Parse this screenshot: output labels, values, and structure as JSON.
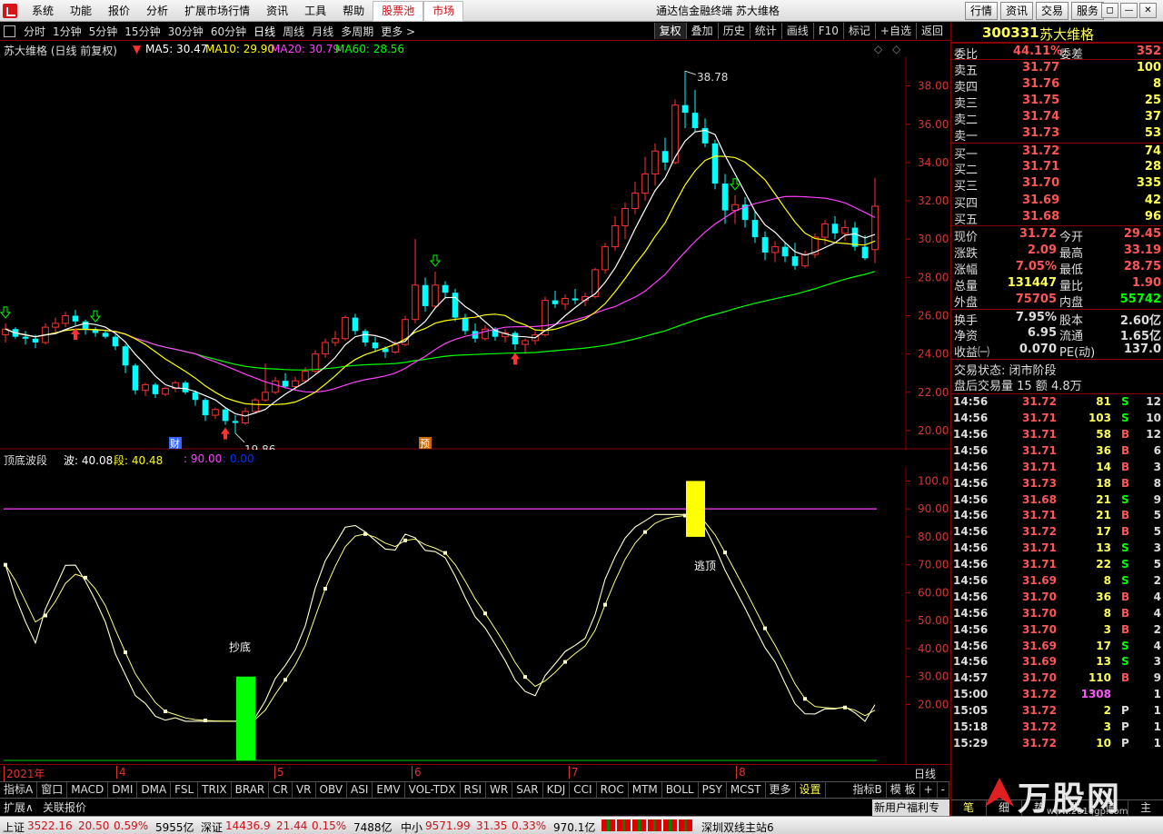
{
  "menu": {
    "items": [
      "系统",
      "功能",
      "报价",
      "分析",
      "扩展市场行情",
      "资讯",
      "工具",
      "帮助"
    ],
    "highlight": [
      "股票池",
      "市场"
    ],
    "title": "通达信金融终端  苏大维格",
    "right_buttons": [
      "行情",
      "资讯",
      "交易",
      "服务"
    ]
  },
  "toolbar": {
    "timeframes": [
      "分时",
      "1分钟",
      "5分钟",
      "15分钟",
      "30分钟",
      "60分钟",
      "日线",
      "周线",
      "月线",
      "多周期",
      "更多 >"
    ],
    "active": "日线",
    "right": [
      "复权",
      "叠加",
      "历史",
      "统计",
      "画线",
      "F10",
      "标记",
      "+自选",
      "返回"
    ]
  },
  "main_chart": {
    "title": "苏大维格 (日线 前复权)",
    "ma5": "MA5: 30.47",
    "ma10": "MA10: 29.90",
    "ma20": "MA20: 30.79",
    "ma60": "MA60: 28.56",
    "high_label": "38.78",
    "low_label": "19.86",
    "marks": [
      "财",
      "预"
    ]
  },
  "indicator": {
    "title": "顶底波段",
    "wave": "波: 40.08",
    "seg": "段: 40.48",
    "val90": ": 90.00",
    "val0": ": 0.00",
    "bottom_label": "抄底",
    "top_label": "逃顶"
  },
  "x_labels": [
    "2021年",
    "4",
    "5",
    "6",
    "7",
    "8"
  ],
  "bottom_right": "日线",
  "indicator_tabs": [
    "指标A",
    "窗口",
    "MACD",
    "DMI",
    "DMA",
    "FSL",
    "TRIX",
    "BRAR",
    "CR",
    "VR",
    "OBV",
    "ASI",
    "EMV",
    "VOL-TDX",
    "RSI",
    "WR",
    "SAR",
    "KDJ",
    "CCI",
    "ROC",
    "MTM",
    "BOLL",
    "PSY",
    "MCST",
    "更多",
    "设置"
  ],
  "indicator_tabs_right": [
    "指标B",
    "模 板",
    "+",
    "-"
  ],
  "expand": {
    "left": "扩展∧",
    "quote": "关联报价",
    "promo": "新用户福利专享"
  },
  "status": {
    "sh": [
      "上证",
      "3522.16",
      "20.50",
      "0.59%",
      "5955亿"
    ],
    "sz": [
      "深证",
      "14436.9",
      "21.44",
      "0.15%",
      "7488亿"
    ],
    "zx": [
      "中小",
      "9571.99",
      "31.35",
      "0.33%",
      "970.1亿"
    ],
    "server": "深圳双线主站6"
  },
  "quote": {
    "code": "300331",
    "name": "苏大维格",
    "weibi_label": "委比",
    "weibi": "44.11%",
    "weicha_label": "委差",
    "weicha": "352",
    "asks": [
      {
        "label": "卖五",
        "price": "31.77",
        "vol": "100"
      },
      {
        "label": "卖四",
        "price": "31.76",
        "vol": "8"
      },
      {
        "label": "卖三",
        "price": "31.75",
        "vol": "25"
      },
      {
        "label": "卖二",
        "price": "31.74",
        "vol": "37"
      },
      {
        "label": "卖一",
        "price": "31.73",
        "vol": "53"
      }
    ],
    "bids": [
      {
        "label": "买一",
        "price": "31.72",
        "vol": "74"
      },
      {
        "label": "买二",
        "price": "31.71",
        "vol": "28"
      },
      {
        "label": "买三",
        "price": "31.70",
        "vol": "335"
      },
      {
        "label": "买四",
        "price": "31.69",
        "vol": "42"
      },
      {
        "label": "买五",
        "price": "31.68",
        "vol": "96"
      }
    ],
    "stats": [
      {
        "l1": "现价",
        "v1": "31.72",
        "l2": "今开",
        "v2": "29.45",
        "c1": "#ff5555",
        "c2": "#ff5555"
      },
      {
        "l1": "涨跌",
        "v1": "2.09",
        "l2": "最高",
        "v2": "33.19",
        "c1": "#ff5555",
        "c2": "#ff5555"
      },
      {
        "l1": "涨幅",
        "v1": "7.05%",
        "l2": "最低",
        "v2": "28.75",
        "c1": "#ff5555",
        "c2": "#ff5555"
      },
      {
        "l1": "总量",
        "v1": "131447",
        "l2": "量比",
        "v2": "1.90",
        "c1": "#ffff54",
        "c2": "#ff5555"
      },
      {
        "l1": "外盘",
        "v1": "75705",
        "l2": "内盘",
        "v2": "55742",
        "c1": "#ff5555",
        "c2": "#00ff00"
      },
      {
        "l1": "换手",
        "v1": "7.95%",
        "l2": "股本",
        "v2": "2.60亿",
        "c1": "#ddd",
        "c2": "#ddd"
      },
      {
        "l1": "净资",
        "v1": "6.95",
        "l2": "流通",
        "v2": "1.65亿",
        "c1": "#ddd",
        "c2": "#ddd"
      },
      {
        "l1": "收益㈠",
        "v1": "0.070",
        "l2": "PE(动)",
        "v2": "137.0",
        "c1": "#ddd",
        "c2": "#ddd"
      }
    ],
    "trade_status": "交易状态: 闭市阶段",
    "after_hours": "盘后交易量 15 额 4.8万"
  },
  "ticks": [
    {
      "t": "14:56",
      "p": "31.72",
      "v": "81",
      "d": "S",
      "n": "12"
    },
    {
      "t": "14:56",
      "p": "31.71",
      "v": "103",
      "d": "S",
      "n": "10"
    },
    {
      "t": "14:56",
      "p": "31.71",
      "v": "58",
      "d": "B",
      "n": "12"
    },
    {
      "t": "14:56",
      "p": "31.71",
      "v": "36",
      "d": "B",
      "n": "6"
    },
    {
      "t": "14:56",
      "p": "31.71",
      "v": "14",
      "d": "B",
      "n": "3"
    },
    {
      "t": "14:56",
      "p": "31.73",
      "v": "18",
      "d": "B",
      "n": "8"
    },
    {
      "t": "14:56",
      "p": "31.68",
      "v": "21",
      "d": "S",
      "n": "9"
    },
    {
      "t": "14:56",
      "p": "31.71",
      "v": "21",
      "d": "B",
      "n": "5"
    },
    {
      "t": "14:56",
      "p": "31.72",
      "v": "17",
      "d": "B",
      "n": "5"
    },
    {
      "t": "14:56",
      "p": "31.71",
      "v": "13",
      "d": "S",
      "n": "3"
    },
    {
      "t": "14:56",
      "p": "31.71",
      "v": "22",
      "d": "S",
      "n": "5"
    },
    {
      "t": "14:56",
      "p": "31.69",
      "v": "8",
      "d": "S",
      "n": "2"
    },
    {
      "t": "14:56",
      "p": "31.70",
      "v": "36",
      "d": "B",
      "n": "4"
    },
    {
      "t": "14:56",
      "p": "31.70",
      "v": "8",
      "d": "B",
      "n": "4"
    },
    {
      "t": "14:56",
      "p": "31.70",
      "v": "3",
      "d": "B",
      "n": "2"
    },
    {
      "t": "14:56",
      "p": "31.69",
      "v": "17",
      "d": "S",
      "n": "4"
    },
    {
      "t": "14:56",
      "p": "31.69",
      "v": "13",
      "d": "S",
      "n": "3"
    },
    {
      "t": "14:57",
      "p": "31.70",
      "v": "110",
      "d": "B",
      "n": "9"
    },
    {
      "t": "15:00",
      "p": "31.72",
      "v": "1308",
      "d": "",
      "n": "1"
    },
    {
      "t": "15:05",
      "p": "31.72",
      "v": "2",
      "d": "P",
      "n": "1"
    },
    {
      "t": "15:18",
      "p": "31.72",
      "v": "3",
      "d": "P",
      "n": "1"
    },
    {
      "t": "15:29",
      "p": "31.72",
      "v": "10",
      "d": "P",
      "n": "1"
    }
  ],
  "right_tabs": [
    "笔",
    "细",
    "势",
    "联",
    "值",
    "主"
  ],
  "brand": {
    "text": "万股网",
    "url": "www.2010gp.com"
  },
  "colors": {
    "up": "#ff3232",
    "down": "#00ffff",
    "ma5": "#ffffff",
    "ma10": "#ffff00",
    "ma20": "#ff40ff",
    "ma60": "#00ff00",
    "frame": "#800000"
  },
  "chart_data": [
    {
      "type": "candlestick",
      "title": "苏大维格 (日线 前复权)",
      "y_ticks": [
        20.0,
        22.0,
        24.0,
        26.0,
        28.0,
        30.0,
        32.0,
        34.0,
        36.0,
        38.0
      ],
      "x_labels": [
        "2021年",
        "4",
        "5",
        "6",
        "7",
        "8"
      ],
      "ylim": [
        19.0,
        39.5
      ],
      "annotations": [
        {
          "text": "38.78",
          "value": 38.78
        },
        {
          "text": "19.86",
          "value": 19.86
        }
      ],
      "series": [
        {
          "name": "MA5",
          "value": 30.47
        },
        {
          "name": "MA10",
          "value": 29.9
        },
        {
          "name": "MA20",
          "value": 30.79
        },
        {
          "name": "MA60",
          "value": 28.56
        }
      ],
      "ohlc": [
        [
          25.0,
          25.6,
          24.6,
          25.3
        ],
        [
          25.3,
          25.4,
          24.8,
          24.9
        ],
        [
          24.9,
          25.2,
          24.5,
          24.8
        ],
        [
          24.8,
          25.0,
          24.3,
          24.6
        ],
        [
          24.6,
          25.6,
          24.5,
          25.4
        ],
        [
          25.4,
          25.9,
          25.1,
          25.6
        ],
        [
          25.6,
          26.2,
          25.4,
          26.0
        ],
        [
          26.0,
          26.3,
          25.5,
          25.7
        ],
        [
          25.7,
          25.8,
          25.0,
          25.3
        ],
        [
          25.3,
          25.4,
          24.9,
          25.1
        ],
        [
          25.1,
          25.2,
          24.8,
          24.9
        ],
        [
          24.9,
          25.0,
          24.2,
          24.4
        ],
        [
          24.4,
          24.5,
          23.0,
          23.4
        ],
        [
          23.4,
          23.5,
          21.9,
          22.1
        ],
        [
          22.1,
          22.5,
          21.8,
          22.4
        ],
        [
          22.4,
          22.5,
          21.7,
          21.9
        ],
        [
          21.9,
          22.3,
          21.8,
          22.2
        ],
        [
          22.2,
          22.6,
          22.0,
          22.5
        ],
        [
          22.5,
          22.6,
          21.9,
          22.0
        ],
        [
          22.0,
          22.1,
          21.3,
          21.6
        ],
        [
          21.6,
          21.7,
          20.5,
          20.8
        ],
        [
          20.8,
          21.2,
          20.6,
          21.1
        ],
        [
          21.1,
          21.2,
          20.3,
          20.5
        ],
        [
          20.5,
          20.8,
          19.86,
          20.4
        ],
        [
          20.4,
          21.2,
          20.3,
          21.0
        ],
        [
          21.0,
          21.7,
          20.9,
          21.6
        ],
        [
          21.6,
          23.5,
          21.5,
          22.0
        ],
        [
          22.0,
          22.8,
          21.9,
          22.6
        ],
        [
          22.6,
          23.0,
          22.2,
          22.3
        ],
        [
          22.3,
          22.8,
          22.1,
          22.6
        ],
        [
          22.6,
          23.3,
          22.5,
          23.1
        ],
        [
          23.1,
          24.2,
          23.0,
          24.0
        ],
        [
          24.0,
          24.8,
          23.8,
          24.6
        ],
        [
          24.6,
          25.2,
          24.4,
          24.8
        ],
        [
          24.8,
          26.0,
          24.7,
          25.9
        ],
        [
          25.9,
          26.1,
          25.0,
          25.2
        ],
        [
          25.2,
          25.3,
          24.4,
          24.6
        ],
        [
          24.6,
          24.9,
          24.1,
          24.3
        ],
        [
          24.3,
          24.4,
          23.8,
          24.1
        ],
        [
          24.1,
          24.7,
          24.0,
          24.5
        ],
        [
          24.5,
          26.0,
          24.4,
          25.8
        ],
        [
          25.8,
          30.0,
          25.6,
          27.6
        ],
        [
          27.6,
          28.0,
          26.2,
          26.5
        ],
        [
          26.5,
          28.3,
          26.4,
          27.6
        ],
        [
          27.6,
          27.8,
          26.9,
          27.2
        ],
        [
          27.2,
          27.4,
          25.7,
          25.9
        ],
        [
          25.9,
          26.1,
          25.0,
          25.2
        ],
        [
          25.2,
          25.6,
          24.6,
          24.8
        ],
        [
          24.8,
          25.5,
          24.7,
          25.3
        ],
        [
          25.3,
          25.4,
          24.7,
          24.9
        ],
        [
          24.9,
          25.3,
          24.6,
          25.1
        ],
        [
          25.1,
          25.2,
          24.2,
          24.5
        ],
        [
          24.5,
          24.8,
          24.0,
          24.7
        ],
        [
          24.7,
          25.2,
          24.5,
          25.0
        ],
        [
          25.0,
          27.0,
          24.9,
          26.8
        ],
        [
          26.8,
          27.3,
          26.4,
          26.6
        ],
        [
          26.6,
          27.1,
          26.3,
          26.9
        ],
        [
          26.9,
          27.4,
          26.6,
          26.8
        ],
        [
          26.8,
          27.2,
          26.5,
          27.0
        ],
        [
          27.0,
          28.5,
          26.9,
          28.4
        ],
        [
          28.4,
          29.8,
          28.2,
          29.6
        ],
        [
          29.6,
          31.2,
          29.4,
          30.7
        ],
        [
          30.7,
          31.9,
          30.0,
          31.6
        ],
        [
          31.6,
          33.0,
          31.3,
          32.4
        ],
        [
          32.4,
          34.3,
          32.0,
          33.4
        ],
        [
          33.4,
          35.0,
          32.8,
          34.6
        ],
        [
          34.6,
          35.3,
          33.6,
          34.0
        ],
        [
          34.0,
          37.3,
          33.9,
          37.0
        ],
        [
          37.0,
          38.78,
          35.8,
          36.6
        ],
        [
          36.6,
          37.8,
          35.6,
          35.8
        ],
        [
          35.8,
          36.3,
          34.8,
          35.0
        ],
        [
          35.0,
          35.2,
          32.6,
          32.9
        ],
        [
          32.9,
          33.4,
          30.8,
          31.5
        ],
        [
          31.5,
          32.3,
          30.8,
          31.8
        ],
        [
          31.8,
          32.2,
          30.6,
          31.0
        ],
        [
          31.0,
          31.5,
          29.8,
          30.1
        ],
        [
          30.1,
          30.4,
          28.9,
          29.3
        ],
        [
          29.3,
          29.9,
          28.8,
          29.6
        ],
        [
          29.6,
          29.8,
          28.8,
          29.1
        ],
        [
          29.1,
          29.8,
          28.4,
          28.6
        ],
        [
          28.6,
          29.4,
          28.5,
          29.2
        ],
        [
          29.2,
          30.3,
          29.0,
          30.1
        ],
        [
          30.1,
          31.0,
          29.7,
          30.8
        ],
        [
          30.8,
          31.2,
          30.0,
          30.3
        ],
        [
          30.3,
          31.0,
          29.9,
          30.6
        ],
        [
          30.6,
          30.9,
          29.4,
          29.6
        ],
        [
          29.6,
          30.2,
          28.9,
          29.0
        ],
        [
          29.45,
          33.19,
          28.75,
          31.72
        ]
      ]
    },
    {
      "type": "line",
      "title": "顶底波段",
      "y_ticks": [
        20.0,
        30.0,
        40.0,
        50.0,
        60.0,
        70.0,
        80.0,
        90.0,
        100.0
      ],
      "ylim": [
        0,
        105
      ],
      "series": [
        {
          "name": "波",
          "value": 40.08
        },
        {
          "name": "段",
          "value": 40.48
        }
      ],
      "reference": [
        {
          "value": 90.0
        },
        {
          "value": 0.0
        }
      ],
      "signals": [
        {
          "text": "抄底",
          "low": 0,
          "high": 30
        },
        {
          "text": "逃顶",
          "low": 80,
          "high": 100
        }
      ]
    }
  ]
}
